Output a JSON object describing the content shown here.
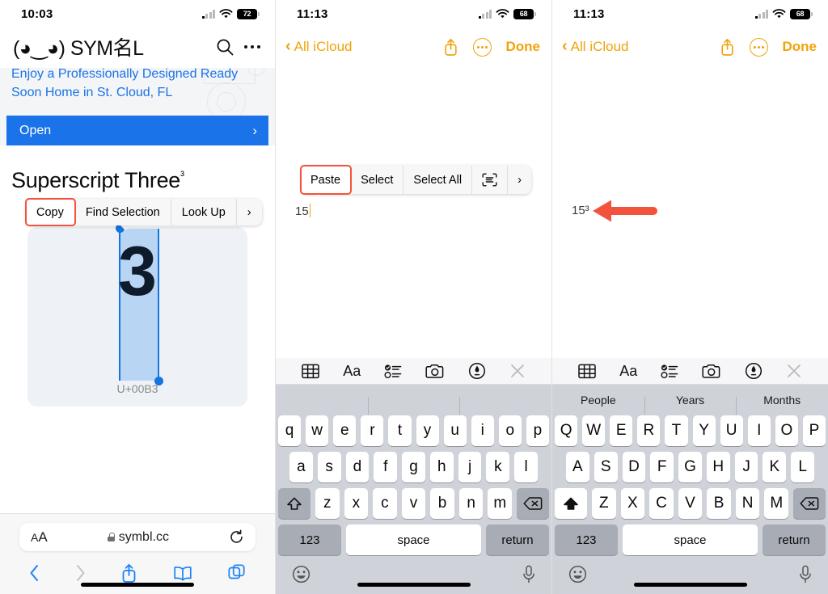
{
  "panel1": {
    "status": {
      "time": "10:03",
      "battery": "72",
      "wifi_icon": "wifi-icon",
      "signal_icon": "cellular-signal-icon"
    },
    "site": {
      "logo": "(◕‿◕) SYM名L",
      "search_icon": "search-icon",
      "more_icon": "more-dots-icon"
    },
    "ad": {
      "headline": "Enjoy a Professionally Designed Ready Soon Home in St. Cloud, FL",
      "cta_label": "Open",
      "cta_chevron": "chevron-right-icon"
    },
    "page": {
      "title": "Superscript Three",
      "title_sup": "³",
      "glyph": "3",
      "code": "U+00B3"
    },
    "context_menu": {
      "items": [
        "Copy",
        "Find Selection",
        "Look Up",
        "›"
      ],
      "highlighted": "Copy"
    },
    "browser": {
      "aa_label": "AA",
      "lock_icon": "lock-icon",
      "url": "symbl.cc",
      "reload_icon": "reload-icon",
      "back_icon": "back-chevron-icon",
      "forward_icon": "forward-chevron-icon",
      "share_icon": "share-icon",
      "bookmarks_icon": "book-icon",
      "tabs_icon": "tabs-icon"
    }
  },
  "panel2": {
    "status": {
      "time": "11:13",
      "battery": "68"
    },
    "nav": {
      "back_label": "All iCloud",
      "back_icon": "back-chevron-icon",
      "share_icon": "share-icon",
      "more_icon": "more-circle-icon",
      "done_label": "Done"
    },
    "note": {
      "text": "15"
    },
    "edit_menu": {
      "items": [
        "Paste",
        "Select",
        "Select All",
        "scan-text-icon",
        "›"
      ],
      "highlighted": "Paste"
    },
    "keyboard": {
      "toolbar_icons": [
        "table-icon",
        "Aa",
        "checklist-icon",
        "camera-icon",
        "markup-icon",
        "close-icon"
      ],
      "predictions": [
        "",
        "",
        ""
      ],
      "row1": [
        "q",
        "w",
        "e",
        "r",
        "t",
        "y",
        "u",
        "i",
        "o",
        "p"
      ],
      "row2": [
        "a",
        "s",
        "d",
        "f",
        "g",
        "h",
        "j",
        "k",
        "l"
      ],
      "row3": [
        "z",
        "x",
        "c",
        "v",
        "b",
        "n",
        "m"
      ],
      "shift_icon": "shift-icon",
      "delete_icon": "delete-icon",
      "num_label": "123",
      "space_label": "space",
      "return_label": "return",
      "emoji_icon": "emoji-icon",
      "mic_icon": "microphone-icon",
      "shift_active": false
    }
  },
  "panel3": {
    "status": {
      "time": "11:13",
      "battery": "68"
    },
    "nav": {
      "back_label": "All iCloud",
      "back_icon": "back-chevron-icon",
      "share_icon": "share-icon",
      "more_icon": "more-circle-icon",
      "done_label": "Done"
    },
    "note": {
      "text": "15³"
    },
    "annotation": {
      "arrow_icon": "red-arrow-left-icon",
      "color": "#f2533c"
    },
    "keyboard": {
      "toolbar_icons": [
        "table-icon",
        "Aa",
        "checklist-icon",
        "camera-icon",
        "markup-icon",
        "close-icon"
      ],
      "predictions": [
        "People",
        "Years",
        "Months"
      ],
      "row1": [
        "Q",
        "W",
        "E",
        "R",
        "T",
        "Y",
        "U",
        "I",
        "O",
        "P"
      ],
      "row2": [
        "A",
        "S",
        "D",
        "F",
        "G",
        "H",
        "J",
        "K",
        "L"
      ],
      "row3": [
        "Z",
        "X",
        "C",
        "V",
        "B",
        "N",
        "M"
      ],
      "shift_icon": "shift-icon",
      "delete_icon": "delete-icon",
      "num_label": "123",
      "space_label": "space",
      "return_label": "return",
      "emoji_icon": "emoji-icon",
      "mic_icon": "microphone-icon",
      "shift_active": true
    }
  },
  "colors": {
    "accent_blue": "#1a73e8",
    "notes_yellow": "#f0a30a",
    "highlight_red": "#f2533c"
  }
}
